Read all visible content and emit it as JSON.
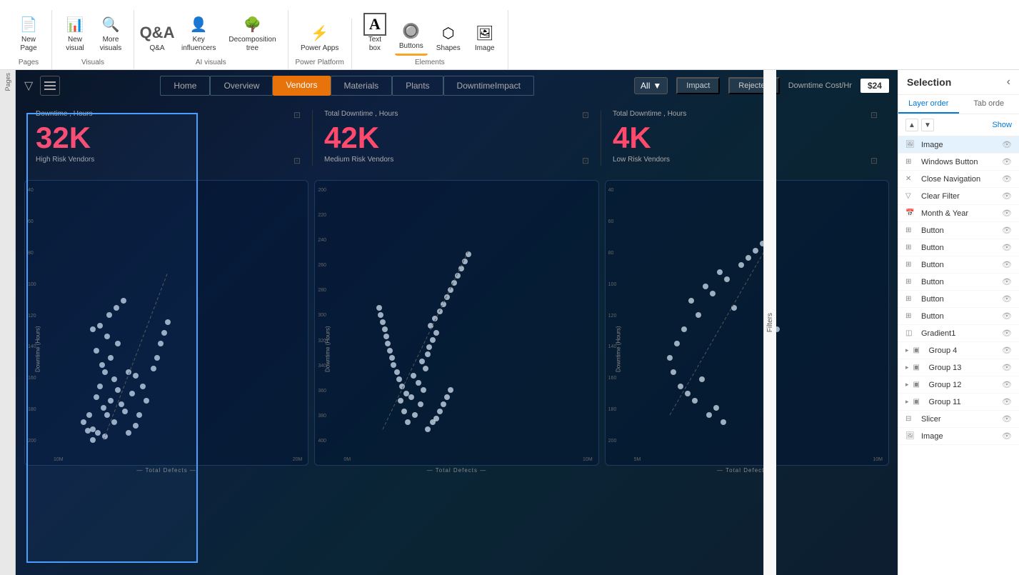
{
  "toolbar": {
    "groups": [
      {
        "label": "Pages",
        "items": [
          {
            "icon": "📄",
            "label": "New\nPage"
          }
        ]
      },
      {
        "label": "Visuals",
        "items": [
          {
            "icon": "📊",
            "label": "New\nvisual"
          },
          {
            "icon": "🔍",
            "label": "More\nvisuals"
          }
        ]
      },
      {
        "label": "AI visuals",
        "items": [
          {
            "icon": "❓",
            "label": "Q&A"
          },
          {
            "icon": "👤",
            "label": "Key\ninfluencers"
          },
          {
            "icon": "🌳",
            "label": "Decomposition\ntree"
          }
        ]
      },
      {
        "label": "Power Platform",
        "items": [
          {
            "icon": "⚡",
            "label": "Power Apps"
          }
        ]
      },
      {
        "label": "Elements",
        "items": [
          {
            "icon": "T",
            "label": "Text\nbox"
          },
          {
            "icon": "🔘",
            "label": "Buttons"
          },
          {
            "icon": "⬡",
            "label": "Shapes"
          },
          {
            "icon": "🖼",
            "label": "Image"
          }
        ]
      }
    ]
  },
  "dashboard": {
    "tabs": [
      "Home",
      "Overview",
      "Vendors",
      "Materials",
      "Plants",
      "DowntimeImpact"
    ],
    "active_tab": "Vendors",
    "filter_dropdown": "All",
    "impact_btn": "Impact",
    "rejected_btn": "Rejected",
    "cost_label": "Downtime Cost/Hr",
    "cost_value": "$24",
    "kpis": [
      {
        "label": "Downtime , Hours",
        "value": "32K",
        "sublabel": "High Risk Vendors"
      },
      {
        "label": "Total Downtime , Hours",
        "value": "42K",
        "sublabel": "Medium Risk Vendors"
      },
      {
        "label": "Total Downtime , Hours",
        "value": "4K",
        "sublabel": "Low Risk Vendors"
      }
    ],
    "charts": [
      {
        "id": "high-risk",
        "y_axis_label": "Downtime (Hours)",
        "x_axis_label": "Total Defects",
        "y_ticks": [
          "200",
          "180",
          "160",
          "140",
          "120",
          "100",
          "80",
          "60",
          "40"
        ],
        "x_ticks": [
          "10M",
          "20M"
        ]
      },
      {
        "id": "medium-risk",
        "y_axis_label": "Downtime (Hours)",
        "x_axis_label": "Total Defects",
        "y_ticks": [
          "400",
          "380",
          "360",
          "340",
          "320",
          "300",
          "280",
          "260",
          "240",
          "220",
          "200"
        ],
        "x_ticks": [
          "0M",
          "10M"
        ]
      },
      {
        "id": "low-risk",
        "y_axis_label": "Downtime (Hours)",
        "x_axis_label": "Total Defects",
        "y_ticks": [
          "200",
          "180",
          "160",
          "140",
          "120",
          "100",
          "80",
          "60",
          "40"
        ],
        "x_ticks": [
          "5M",
          "10M"
        ]
      }
    ]
  },
  "selection_panel": {
    "title": "Selection",
    "tabs": [
      "Layer order",
      "Tab orde"
    ],
    "active_tab": "Layer order",
    "show_label": "Show",
    "filters_label": "Filters",
    "layers": [
      {
        "name": "Image",
        "type": "image",
        "selected": true
      },
      {
        "name": "Windows Button",
        "type": "button"
      },
      {
        "name": "Close Navigation",
        "type": "nav"
      },
      {
        "name": "Clear Filter",
        "type": "filter"
      },
      {
        "name": "Month & Year",
        "type": "date"
      },
      {
        "name": "Button",
        "type": "button"
      },
      {
        "name": "Button",
        "type": "button"
      },
      {
        "name": "Button",
        "type": "button"
      },
      {
        "name": "Button",
        "type": "button"
      },
      {
        "name": "Button",
        "type": "button"
      },
      {
        "name": "Button",
        "type": "button"
      },
      {
        "name": "Gradient1",
        "type": "shape"
      },
      {
        "name": "Group 4",
        "type": "group",
        "expanded": true
      },
      {
        "name": "Group 13",
        "type": "group",
        "expanded": true
      },
      {
        "name": "Group 12",
        "type": "group",
        "expanded": true
      },
      {
        "name": "Group 11",
        "type": "group",
        "expanded": true
      },
      {
        "name": "Slicer",
        "type": "slicer"
      },
      {
        "name": "Image",
        "type": "image"
      }
    ]
  }
}
